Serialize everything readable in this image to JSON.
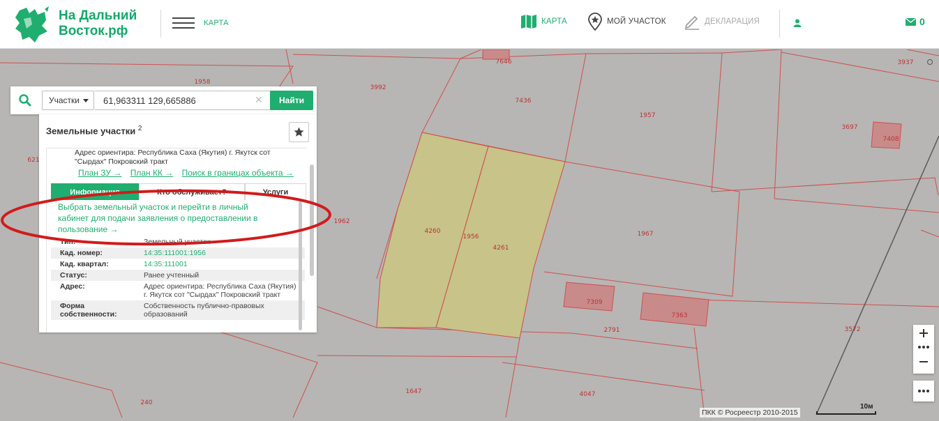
{
  "brand": {
    "name_line1": "На Дальний",
    "name_line2": "Восток.рф"
  },
  "header": {
    "section_label": "Карта",
    "nav": [
      {
        "label": "Карта",
        "icon": "map-icon",
        "active": true
      },
      {
        "label": "Мой участок",
        "icon": "star-badge-icon",
        "active": false
      },
      {
        "label": "Декларация",
        "icon": "pencil-icon",
        "active": false
      }
    ],
    "mail_count": "0"
  },
  "colors": {
    "brand_green": "#1fae6f",
    "plot_fill": "#c7c389",
    "plot_border": "#d04a4a",
    "annotation_red": "#d11b1b"
  },
  "search": {
    "type_value": "Участки",
    "coords_value": "61,963311 129,665886",
    "clear_symbol": "✕",
    "find_label": "Найти"
  },
  "panel": {
    "title": "Земельные участки",
    "title_count": "2",
    "address_top": "Адрес ориентира: Республика Саха (Якутия) г. Якутск сот \"Сырдах\" Покровский тракт",
    "links": [
      "План ЗУ →",
      "План КК →",
      "Поиск в границах объекта →"
    ],
    "tabs": [
      "Информация",
      "Кто обслуживает?",
      "Услуги"
    ],
    "select_link": "Выбрать земельный участок и перейти в личный кабинет для подачи заявления о предоставлении в пользование →",
    "attributes": [
      {
        "key": "Тип:",
        "value": "Земельный участок",
        "link": false
      },
      {
        "key": "Кад. номер:",
        "value": "14:35:111001:1956",
        "link": true
      },
      {
        "key": "Кад. квартал:",
        "value": "14:35:111001",
        "link": true
      },
      {
        "key": "Статус:",
        "value": "Ранее учтенный",
        "link": false
      },
      {
        "key": "Адрес:",
        "value": "Адрес ориентира: Республика Саха (Якутия) г. Якутск сот \"Сырдах\" Покровский тракт",
        "link": false
      },
      {
        "key": "Форма собственности:",
        "value": "Собственность публично-правовых образований",
        "link": false
      }
    ]
  },
  "map": {
    "parcel_labels": [
      "1956",
      "4260",
      "4261",
      "1957",
      "1962",
      "1967",
      "3992",
      "7436",
      "7646",
      "3937",
      "3697",
      "7408",
      "7309",
      "7363",
      "2791",
      "3572",
      "1647",
      "4047",
      "240",
      "621",
      "1958"
    ]
  },
  "footer": {
    "attribution": "ПКК © Росреестр 2010-2015",
    "scale": "10м"
  }
}
